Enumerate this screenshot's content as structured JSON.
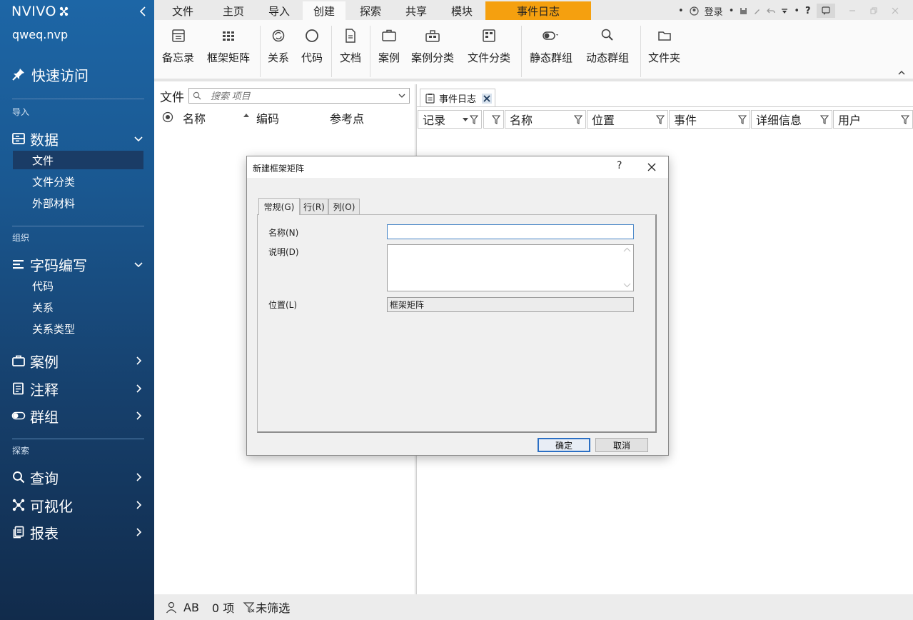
{
  "sidebar": {
    "brand": "NVIVO",
    "project": "qweq.nvp",
    "quick_access": "快速访问",
    "section_import": "导入",
    "data": {
      "label": "数据",
      "items": [
        "文件",
        "文件分类",
        "外部材料"
      ]
    },
    "section_organize": "组织",
    "coding": {
      "label": "字码编写",
      "items": [
        "代码",
        "关系",
        "关系类型"
      ]
    },
    "cases": "案例",
    "notes": "注释",
    "groups": "群组",
    "section_explore": "探索",
    "query": "查询",
    "visualize": "可视化",
    "reports": "报表"
  },
  "tabs": [
    "文件",
    "主页",
    "导入",
    "创建",
    "探索",
    "共享",
    "模块"
  ],
  "selected_tab": "创建",
  "context_tab": "事件日志",
  "top_right": {
    "login": "登录",
    "help": "?"
  },
  "ribbon": {
    "memo": "备忘录",
    "framework_matrix": "框架矩阵",
    "relationship": "关系",
    "code": "代码",
    "document": "文档",
    "case": "案例",
    "case_classification": "案例分类",
    "file_classification": "文件分类",
    "static_set": "静态群组",
    "dynamic_set": "动态群组",
    "folder": "文件夹"
  },
  "file_pane": {
    "title": "文件",
    "search_placeholder": "搜索 项目",
    "columns": {
      "name": "名称",
      "codes": "编码",
      "references": "参考点"
    }
  },
  "detail": {
    "tab_label": "事件日志",
    "columns": [
      "记录",
      "",
      "名称",
      "位置",
      "事件",
      "详细信息",
      "用户"
    ]
  },
  "status": {
    "user": "AB",
    "count": "0 项",
    "filter": "未筛选"
  },
  "dialog": {
    "title": "新建框架矩阵",
    "help": "?",
    "tabs": [
      "常规(G)",
      "行(R)",
      "列(O)"
    ],
    "name_label": "名称(N)",
    "name_value": "",
    "desc_label": "说明(D)",
    "desc_value": "",
    "location_label": "位置(L)",
    "location_value": "框架矩阵",
    "ok": "确定",
    "cancel": "取消"
  },
  "colors": {
    "accent_orange": "#f5a00f",
    "sidebar_top": "#1d66a6",
    "sidebar_bottom": "#112b4b",
    "focus_blue": "#2b6fc4"
  }
}
